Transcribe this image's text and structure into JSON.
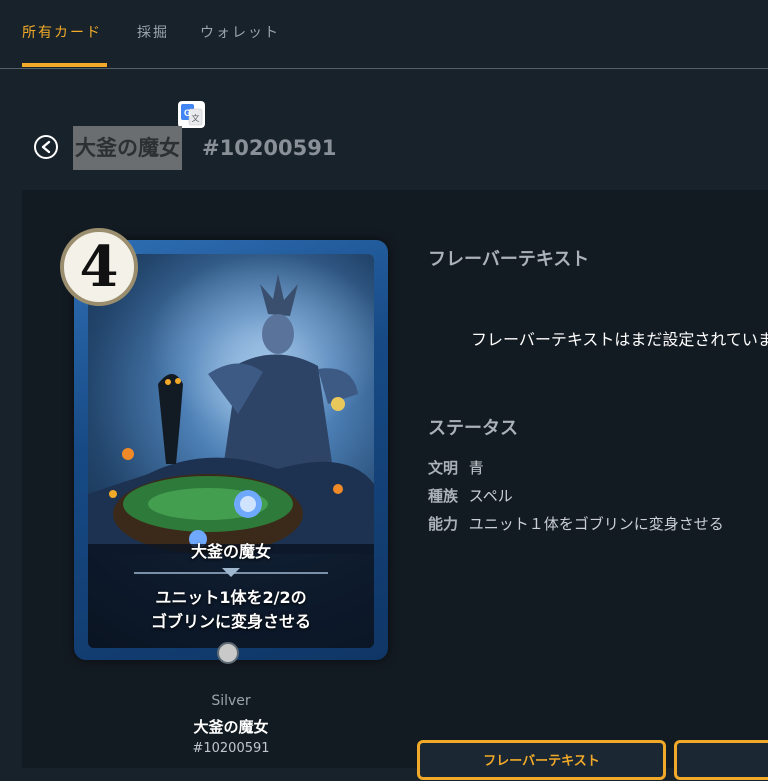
{
  "nav": {
    "tabs": [
      {
        "label": "所有カード",
        "active": true
      },
      {
        "label": "採掘",
        "active": false
      },
      {
        "label": "ウォレット",
        "active": false
      }
    ]
  },
  "header": {
    "title": "大釜の魔女",
    "card_number": "#10200591"
  },
  "card": {
    "cost": "4",
    "name": "大釜の魔女",
    "ability_line1": "ユニット1体を2/2の",
    "ability_line2": "ゴブリンに変身させる",
    "rarity": "Silver",
    "card_number": "#10200591"
  },
  "details": {
    "flavor_heading": "フレーバーテキスト",
    "flavor_text": "フレーバーテキストはまだ設定されていま",
    "status_heading": "ステータス",
    "stats": [
      {
        "key": "文明",
        "value": "青"
      },
      {
        "key": "種族",
        "value": "スペル"
      },
      {
        "key": "能力",
        "value": "ユニット１体をゴブリンに変身させる"
      }
    ]
  },
  "buttons": {
    "flavor_button": "フレーバーテキスト",
    "second_button": ""
  },
  "colors": {
    "accent": "#f0a928",
    "background": "#18222b",
    "panel": "#131b22"
  }
}
